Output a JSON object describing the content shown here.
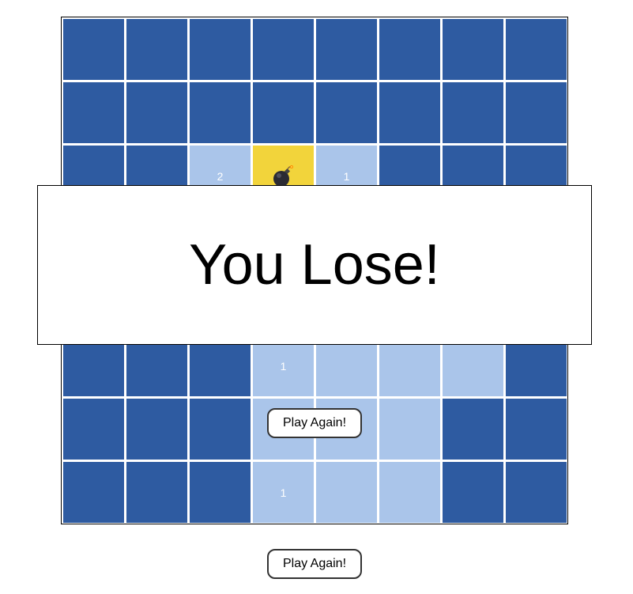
{
  "game": {
    "rows": 8,
    "cols": 8,
    "colors": {
      "hidden": "#2e5ba1",
      "revealed": "#aac5ea",
      "mine": "#f2d43b",
      "number_text": "#ffffff"
    },
    "grid": [
      [
        "H",
        "H",
        "H",
        "H",
        "H",
        "H",
        "H",
        "H"
      ],
      [
        "H",
        "H",
        "H",
        "H",
        "H",
        "H",
        "H",
        "H"
      ],
      [
        "H",
        "H",
        "2",
        "M",
        "1",
        "H",
        "H",
        "H"
      ],
      [
        "H",
        "H",
        "H",
        "H",
        "H",
        "H",
        "H",
        "H"
      ],
      [
        "H",
        "H",
        "H",
        "H",
        "H",
        "H",
        "H",
        "H"
      ],
      [
        "H",
        "H",
        "H",
        "1",
        "R",
        "R",
        "R",
        "H"
      ],
      [
        "H",
        "H",
        "H",
        "R",
        "R",
        "R",
        "H",
        "H"
      ],
      [
        "H",
        "H",
        "H",
        "1",
        "R",
        "R",
        "H",
        "H"
      ]
    ],
    "mine_icon": "bomb-icon"
  },
  "overlay": {
    "title": "You Lose!",
    "button_label": "Play Again!"
  },
  "footer": {
    "button_label": "Play Again!"
  }
}
